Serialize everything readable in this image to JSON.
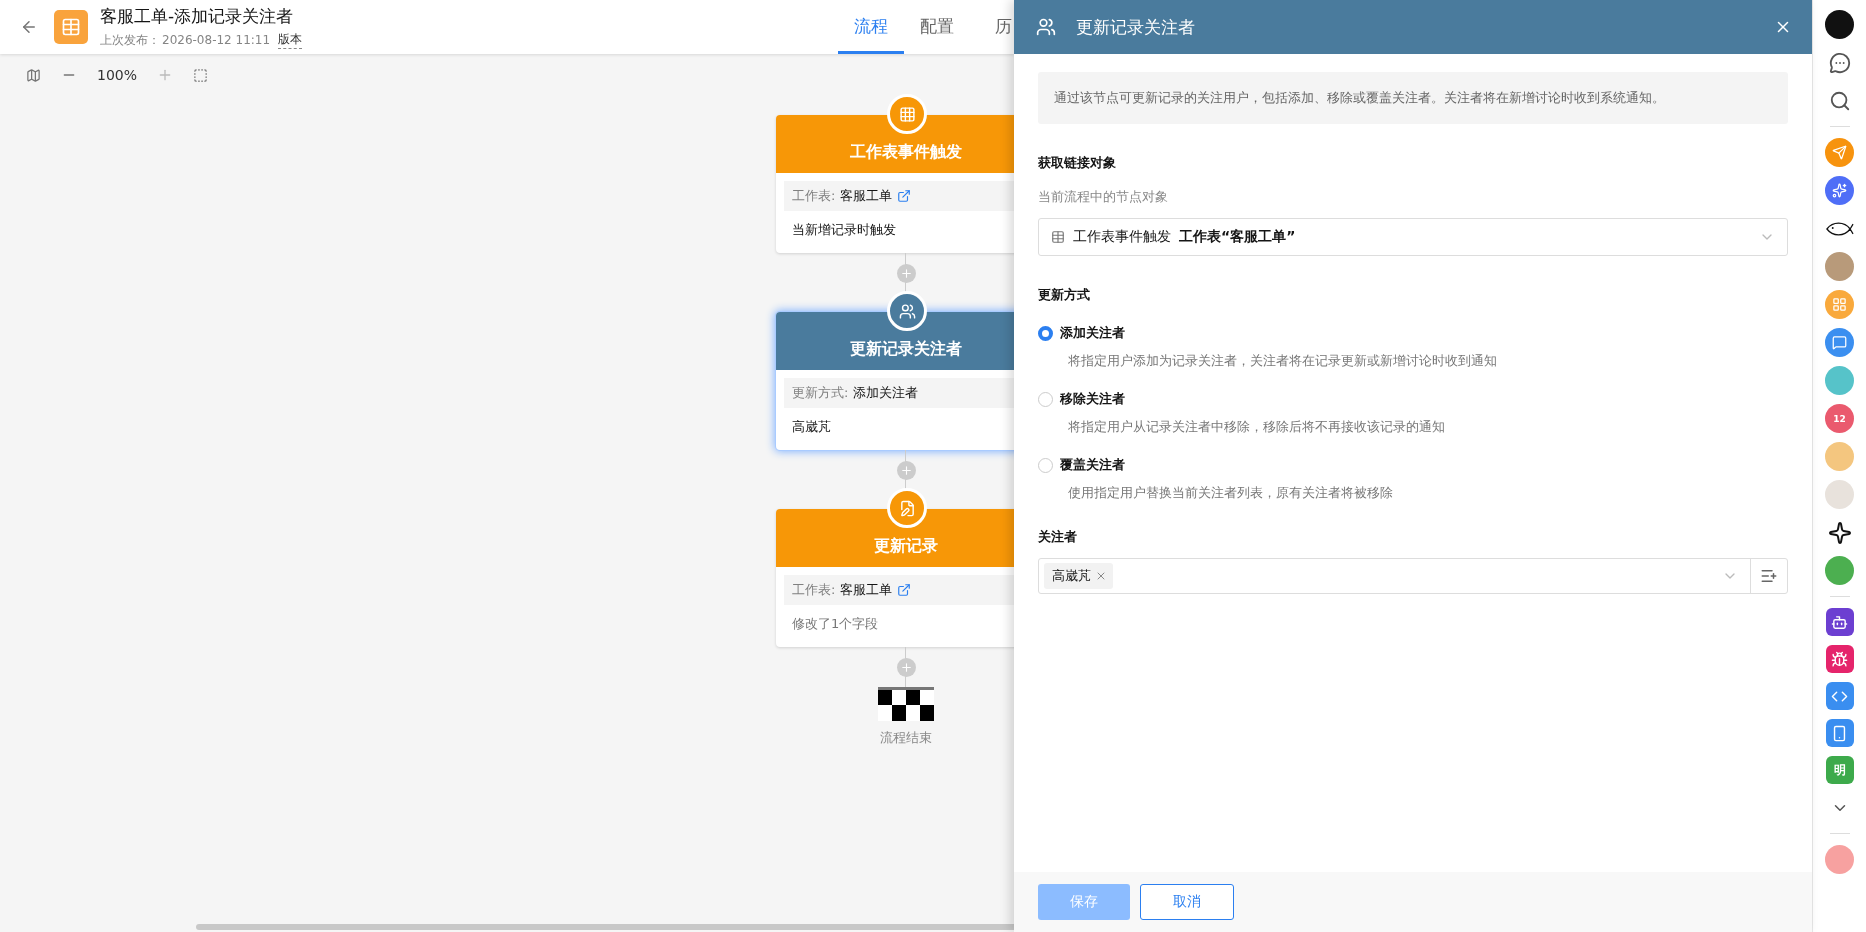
{
  "header": {
    "title": "客服工单-添加记录关注者",
    "published_label": "上次发布：",
    "published_time": "2026-08-12 11:11",
    "version_link": "版本",
    "tabs": [
      {
        "label": "流程",
        "selected": true
      },
      {
        "label": "配置",
        "selected": false
      },
      {
        "label": "历",
        "selected": false
      }
    ]
  },
  "toolbar": {
    "zoom": "100%"
  },
  "flow": {
    "nodes": [
      {
        "kind": "trigger",
        "title": "工作表事件触发",
        "selected": false,
        "field_label": "工作表:",
        "field_value": "客服工单",
        "link": true,
        "note": "当新增记录时触发",
        "note_muted": false
      },
      {
        "kind": "followers",
        "title": "更新记录关注者",
        "selected": true,
        "field_label": "更新方式:",
        "field_value": "添加关注者",
        "link": false,
        "note": "高崴芃",
        "note_muted": false
      },
      {
        "kind": "update",
        "title": "更新记录",
        "selected": false,
        "field_label": "工作表:",
        "field_value": "客服工单",
        "link": true,
        "note": "修改了1个字段",
        "note_muted": true
      }
    ],
    "end_label": "流程结束"
  },
  "panel": {
    "title": "更新记录关注者",
    "info": "通过该节点可更新记录的关注用户，包括添加、移除或覆盖关注者。关注者将在新增讨论时收到系统通知。",
    "source": {
      "label": "获取链接对象",
      "hint": "当前流程中的节点对象",
      "node": "工作表事件触发",
      "table": "工作表“客服工单”"
    },
    "mode": {
      "label": "更新方式",
      "options": [
        {
          "label": "添加关注者",
          "description": "将指定用户添加为记录关注者，关注者将在记录更新或新增讨论时收到通知",
          "selected": true
        },
        {
          "label": "移除关注者",
          "description": "将指定用户从记录关注者中移除，移除后将不再接收该记录的通知",
          "selected": false
        },
        {
          "label": "覆盖关注者",
          "description": "使用指定用户替换当前关注者列表，原有关注者将被移除",
          "selected": false
        }
      ]
    },
    "followers": {
      "label": "关注者",
      "tags": [
        "高崴芃"
      ]
    },
    "save": {
      "label": "保存",
      "disabled": true
    },
    "cancel": {
      "label": "取消"
    }
  },
  "sidebar": {
    "items": [
      {
        "kind": "avatar",
        "color": "#111111"
      },
      {
        "kind": "chat"
      },
      {
        "kind": "search"
      },
      {
        "kind": "divider"
      },
      {
        "kind": "send",
        "color": "#f7930e"
      },
      {
        "kind": "spark",
        "color": "#4f6ef7"
      },
      {
        "kind": "fish"
      },
      {
        "kind": "avatar",
        "color": "#b89a7a"
      },
      {
        "kind": "grid",
        "color": "#f9a93c"
      },
      {
        "kind": "message",
        "color": "#3b8ff0"
      },
      {
        "kind": "avatar",
        "color": "#56c3c9"
      },
      {
        "kind": "calendar",
        "color": "#ea5a6e",
        "label": "12"
      },
      {
        "kind": "avatar",
        "color": "#f4c67f"
      },
      {
        "kind": "avatar",
        "color": "#e8e2dc"
      },
      {
        "kind": "sparkle"
      },
      {
        "kind": "avatar",
        "color": "#4caf50"
      },
      {
        "kind": "divider"
      },
      {
        "kind": "bot",
        "color": "#6c3fd1"
      },
      {
        "kind": "bug",
        "color": "#e5246b"
      },
      {
        "kind": "code",
        "color": "#3a8ef0"
      },
      {
        "kind": "phone",
        "color": "#3a8ef0"
      },
      {
        "kind": "text",
        "color": "#3daa4b",
        "label": "明"
      },
      {
        "kind": "more"
      },
      {
        "kind": "divider"
      },
      {
        "kind": "avatar",
        "color": "#f7a1a0"
      }
    ]
  }
}
